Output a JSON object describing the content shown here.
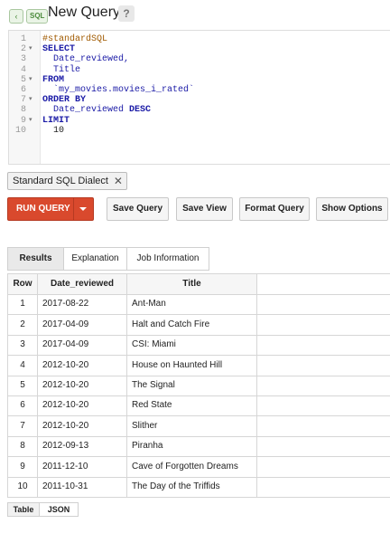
{
  "header": {
    "back_icon": "‹",
    "sql_badge": "SQL",
    "title": "New Query",
    "help_icon": "?"
  },
  "editor": {
    "lines": [
      {
        "n": "1",
        "fold": "",
        "parts": [
          {
            "t": "#standardSQL",
            "c": "comment"
          }
        ]
      },
      {
        "n": "2",
        "fold": "▾",
        "parts": [
          {
            "t": "SELECT",
            "c": "kw"
          }
        ]
      },
      {
        "n": "3",
        "fold": "",
        "parts": [
          {
            "t": "  Date_reviewed,",
            "c": "ident"
          }
        ]
      },
      {
        "n": "4",
        "fold": "",
        "parts": [
          {
            "t": "  Title",
            "c": "ident"
          }
        ]
      },
      {
        "n": "5",
        "fold": "▾",
        "parts": [
          {
            "t": "FROM",
            "c": "kw"
          }
        ]
      },
      {
        "n": "6",
        "fold": "",
        "parts": [
          {
            "t": "  `my_movies.movies_i_rated`",
            "c": "ident"
          }
        ]
      },
      {
        "n": "7",
        "fold": "▾",
        "parts": [
          {
            "t": "ORDER BY",
            "c": "kw"
          }
        ]
      },
      {
        "n": "8",
        "fold": "",
        "parts": [
          {
            "t": "  Date_reviewed ",
            "c": "ident"
          },
          {
            "t": "DESC",
            "c": "kw"
          }
        ]
      },
      {
        "n": "9",
        "fold": "▾",
        "parts": [
          {
            "t": "LIMIT",
            "c": "kw"
          }
        ]
      },
      {
        "n": "10",
        "fold": "",
        "parts": [
          {
            "t": "  10",
            "c": "num"
          }
        ]
      }
    ]
  },
  "dialect": {
    "label": "Standard SQL Dialect",
    "close": "✕"
  },
  "toolbar": {
    "run_label": "RUN QUERY",
    "save_query": "Save Query",
    "save_view": "Save View",
    "format_query": "Format Query",
    "show_options": "Show Options"
  },
  "tabs": [
    "Results",
    "Explanation",
    "Job Information"
  ],
  "results": {
    "columns": [
      "Row",
      "Date_reviewed",
      "Title"
    ],
    "rows": [
      [
        "1",
        "2017-08-22",
        "Ant-Man"
      ],
      [
        "2",
        "2017-04-09",
        "Halt and Catch Fire"
      ],
      [
        "3",
        "2017-04-09",
        "CSI: Miami"
      ],
      [
        "4",
        "2012-10-20",
        "House on Haunted Hill"
      ],
      [
        "5",
        "2012-10-20",
        "The Signal"
      ],
      [
        "6",
        "2012-10-20",
        "Red State"
      ],
      [
        "7",
        "2012-10-20",
        "Slither"
      ],
      [
        "8",
        "2012-09-13",
        "Piranha"
      ],
      [
        "9",
        "2011-12-10",
        "Cave of Forgotten Dreams"
      ],
      [
        "10",
        "2011-10-31",
        "The Day of the Triffids"
      ]
    ]
  },
  "view_toggle": [
    "Table",
    "JSON"
  ],
  "colors": {
    "run_button": "#d9492d",
    "keyword": "#1a1aa6",
    "comment": "#a05a00"
  }
}
